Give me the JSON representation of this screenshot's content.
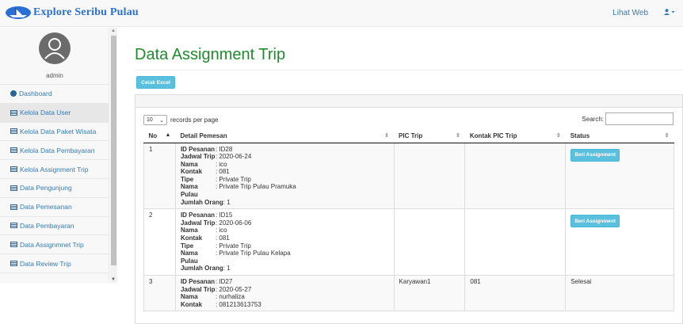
{
  "brand": {
    "title": "Explore Seribu Pulau"
  },
  "header": {
    "view_site_label": "Lihat Web",
    "user_icon": "user-icon"
  },
  "sidebar": {
    "username": "admin",
    "items": [
      {
        "label": "Dashboard",
        "icon": "dashboard-icon"
      },
      {
        "label": "Kelola Data User",
        "icon": "table-icon"
      },
      {
        "label": "Kelola Data Paket Wisata",
        "icon": "table-icon"
      },
      {
        "label": "Kelola Data Pembayaran",
        "icon": "table-icon"
      },
      {
        "label": "Kelola Assignment Trip",
        "icon": "table-icon"
      },
      {
        "label": "Data Pengunjung",
        "icon": "table-icon"
      },
      {
        "label": "Data Pemesanan",
        "icon": "table-icon"
      },
      {
        "label": "Data Pembayaran",
        "icon": "table-icon"
      },
      {
        "label": "Data Assignmnet Trip",
        "icon": "table-icon"
      },
      {
        "label": "Data Review Trip",
        "icon": "table-icon"
      }
    ]
  },
  "main": {
    "title": "Data Assignment Trip",
    "export_label": "Cetak Excel",
    "length": {
      "value": "10",
      "suffix": "records per page"
    },
    "search_label": "Search:",
    "columns": [
      "No",
      "Detail Pemesan",
      "PIC Trip",
      "Kontak PIC Trip",
      "Status"
    ],
    "detail_keys": [
      "ID Pesanan",
      "Jadwal Trip",
      "Nama",
      "Kontak",
      "Tipe",
      "Nama Pulau",
      "Jumlah Orang"
    ],
    "rows": [
      {
        "no": "1",
        "detail": [
          ": ID28",
          ": 2020-06-24",
          ": ico",
          ": 081",
          ": Private Trip",
          ": Private Trip Pulau Pramuka",
          ": 1"
        ],
        "pic": "",
        "pic_contact": "",
        "status": "",
        "action_label": "Beri Assignment"
      },
      {
        "no": "2",
        "detail": [
          ": ID15",
          ": 2020-06-06",
          ": ico",
          ": 081",
          ": Private Trip",
          ": Private Trip Pulau Kelapa",
          ": 1"
        ],
        "pic": "",
        "pic_contact": "",
        "status": "",
        "action_label": "Beri Assignment"
      },
      {
        "no": "3",
        "detail": [
          ": ID27",
          ": 2020-05-27",
          ": nurhaliza",
          ": 081213613753"
        ],
        "pic": "Karyawan1",
        "pic_contact": "081",
        "status": "Selesai",
        "action_label": ""
      }
    ]
  }
}
